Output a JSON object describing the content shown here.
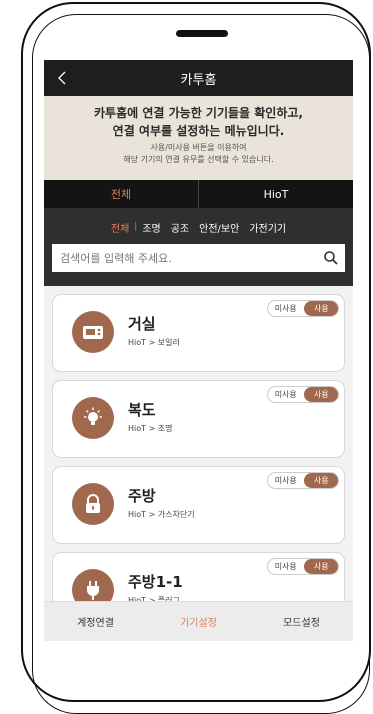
{
  "header": {
    "title": "카투홈"
  },
  "info": {
    "line1": "카투홈에 연결 가능한 기기들을 확인하고,",
    "line2": "연결 여부를 설정하는 메뉴입니다.",
    "line3": "사용/미사용 버튼을 이용하여",
    "line4": "해당 기기의 연결 유무를 선택할 수 있습니다."
  },
  "tabs": [
    {
      "label": "전체"
    },
    {
      "label": "HioT"
    }
  ],
  "categories": [
    {
      "label": "전체"
    },
    {
      "label": "조명"
    },
    {
      "label": "공조"
    },
    {
      "label": "안전/보안"
    },
    {
      "label": "가전기기"
    }
  ],
  "search": {
    "placeholder": "검색어를 입력해 주세요."
  },
  "devices": [
    {
      "name": "거실",
      "path": "HioT > 보일러",
      "icon": "boiler-icon",
      "off_label": "미사용",
      "on_label": "사용"
    },
    {
      "name": "복도",
      "path": "HioT > 조명",
      "icon": "light-bulb-icon",
      "off_label": "미사용",
      "on_label": "사용"
    },
    {
      "name": "주방",
      "path": "HioT > 가스차단기",
      "icon": "lock-icon",
      "off_label": "미사용",
      "on_label": "사용"
    },
    {
      "name": "주방1-1",
      "path": "HioT > 플러그",
      "icon": "plug-icon",
      "off_label": "미사용",
      "on_label": "사용"
    }
  ],
  "bottom_nav": [
    {
      "label": "계정연결"
    },
    {
      "label": "기기설정"
    },
    {
      "label": "모드설정"
    }
  ],
  "colors": {
    "accent": "#e07e5c",
    "brand": "#a0684c",
    "header": "#1e1e1e"
  }
}
